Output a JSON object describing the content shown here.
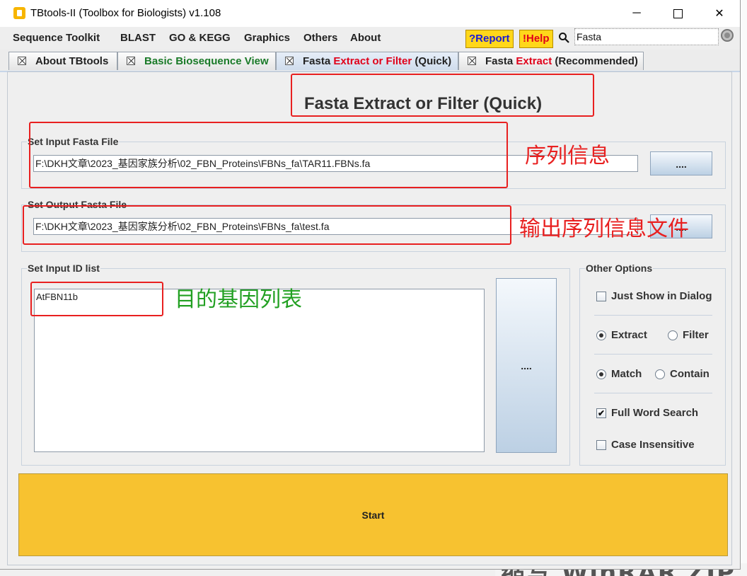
{
  "window": {
    "title": "TBtools-II (Toolbox for Biologists) v1.108",
    "controls": {
      "minimize": "─",
      "maximize": "",
      "close": "✕"
    }
  },
  "menu": {
    "items": [
      "Sequence Toolkit",
      "BLAST",
      "GO & KEGG",
      "Graphics",
      "Others",
      "About"
    ],
    "report_label": "?Report",
    "help_label": "!Help",
    "search_value": "Fasta"
  },
  "tabs": [
    {
      "close": "",
      "parts": [
        "About TBtools"
      ]
    },
    {
      "close": "",
      "parts": [
        "Basic Biosequence View"
      ]
    },
    {
      "close": "",
      "parts": [
        "Fasta ",
        "Extract or Filter",
        " (Quick)"
      ]
    },
    {
      "close": "",
      "parts": [
        "Fasta ",
        "Extract",
        " (Recommended)"
      ]
    }
  ],
  "main": {
    "title": "Fasta Extract or Filter (Quick)",
    "input_fasta": {
      "label": "Set Input Fasta File",
      "value": "F:\\DKH文章\\2023_基因家族分析\\02_FBN_Proteins\\FBNs_fa\\TAR11.FBNs.fa",
      "browse_label": "...."
    },
    "output_fasta": {
      "label": "Set Output Fasta File",
      "value": "F:\\DKH文章\\2023_基因家族分析\\02_FBN_Proteins\\FBNs_fa\\test.fa",
      "browse_label": "...."
    },
    "id_list": {
      "label": "Set Input ID list",
      "value": "AtFBN11b",
      "browse_label": "...."
    },
    "options": {
      "label": "Other Options",
      "just_show": {
        "label": "Just Show in Dialog",
        "checked": false
      },
      "extract": {
        "label": "Extract",
        "selected": true
      },
      "filter": {
        "label": "Filter",
        "selected": false
      },
      "match": {
        "label": "Match",
        "selected": true
      },
      "contain": {
        "label": "Contain",
        "selected": false
      },
      "full_word": {
        "label": "Full Word Search",
        "checked": true,
        "mark": "✔"
      },
      "case_insensitive": {
        "label": "Case Insensitive",
        "checked": false
      }
    },
    "start_label": "Start"
  },
  "annotations": {
    "seq_info": "序列信息",
    "output_info": "输出序列信息文件",
    "target_genes": "目的基因列表"
  },
  "background": {
    "taskbar_text": "缩写 WinRAR ZIP"
  },
  "colors": {
    "accent_red": "#e0001a",
    "accent_green": "#1a7a28",
    "start_yellow": "#f7c230",
    "annotation_red": "#e82020",
    "annotation_green": "#22a022"
  }
}
